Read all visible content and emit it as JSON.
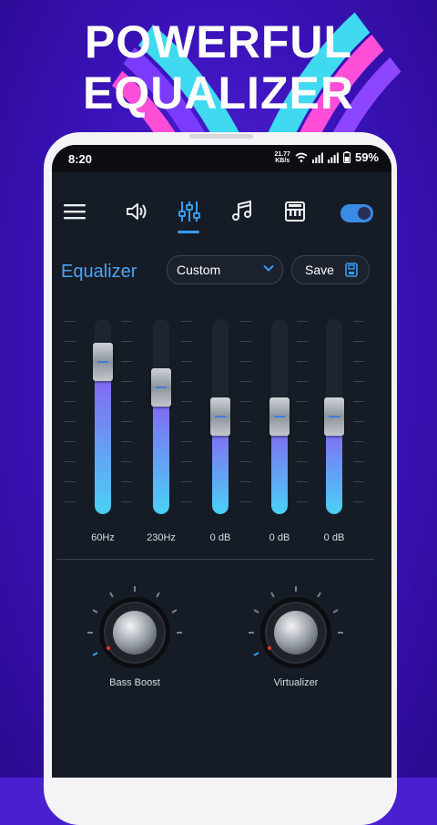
{
  "promo": {
    "line1": "POWERFUL",
    "line2": "EQUALIZER"
  },
  "status": {
    "time": "8:20",
    "net_speed_value": "21.77",
    "net_speed_unit": "KB/s",
    "battery": "59%"
  },
  "toolbar": {
    "icons": [
      "menu-icon",
      "volume-icon",
      "equalizer-icon",
      "music-note-icon",
      "piano-icon"
    ],
    "active_tab": "equalizer",
    "toggle_on": true
  },
  "equalizer": {
    "title": "Equalizer",
    "preset": "Custom",
    "save_label": "Save",
    "bands": [
      {
        "label": "60Hz",
        "level": 0.78
      },
      {
        "label": "230Hz",
        "level": 0.65
      },
      {
        "label": "0 dB",
        "level": 0.5
      },
      {
        "label": "0 dB",
        "level": 0.5
      },
      {
        "label": "0 dB",
        "level": 0.5
      }
    ]
  },
  "effects": {
    "bass_boost": {
      "label": "Bass Boost",
      "level": 0.05
    },
    "virtualizer": {
      "label": "Virtualizer",
      "level": 0.05
    }
  },
  "colors": {
    "accent": "#4aa3f5",
    "fill_top": "#8a5cf2",
    "fill_bottom": "#4ad1f5"
  }
}
